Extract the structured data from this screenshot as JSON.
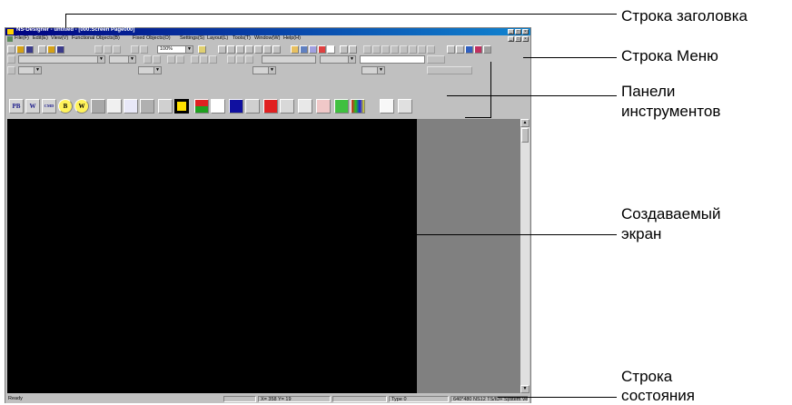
{
  "window": {
    "title": "NS-Designer - untitled - [000:Screen Page000]",
    "controls": [
      "_",
      "□",
      "×"
    ],
    "doc_controls": [
      "_",
      "□",
      "×"
    ]
  },
  "menu": {
    "items": [
      "File(F)",
      "Edit(E)",
      "View(V)",
      "Functional Objects(B)",
      "Fixed Objects(O)",
      "Settings(S)",
      "Layout(L)",
      "Tools(T)",
      "Window(W)",
      "Help(H)"
    ]
  },
  "toolbar": {
    "zoom_value": "100%"
  },
  "object_palette": {
    "labels": [
      "PB",
      "W",
      "CMD",
      "B",
      "W",
      "",
      "",
      "",
      "",
      "",
      "",
      "",
      "",
      "",
      "",
      "",
      "",
      "",
      "",
      "",
      "",
      "",
      ""
    ]
  },
  "status_bar": {
    "ready": "Ready",
    "coords": "X= 358 Y= 19",
    "type": "Type 0",
    "device": "640*480 NS12 TS/ID+ System Ver6.0"
  },
  "annotations": {
    "title_bar": "Строка заголовка",
    "menu_bar": "Строка Меню",
    "toolbars_1": "Панели",
    "toolbars_2": "инструментов",
    "screen_1": "Создаваемый",
    "screen_2": "экран",
    "status_1": "Строка",
    "status_2": "состояния"
  },
  "colors": {
    "title_bar": "#000080",
    "screen": "#000000",
    "workspace": "#808080",
    "chrome": "#c0c0c0"
  }
}
